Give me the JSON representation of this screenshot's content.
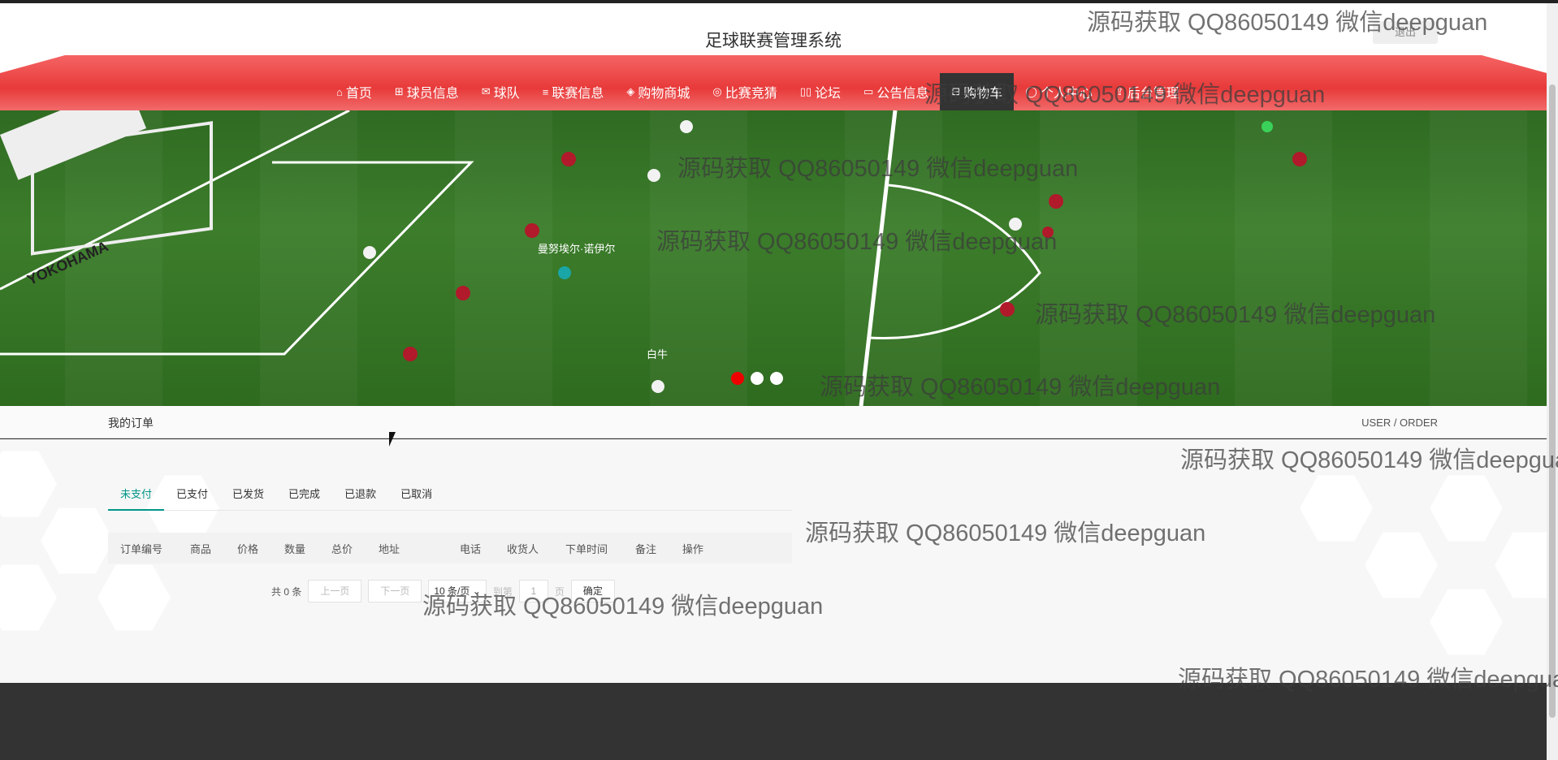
{
  "header": {
    "title": "足球联赛管理系统",
    "logout_label": "退出"
  },
  "nav": {
    "items": [
      {
        "icon": "⌂",
        "icon_name": "home-icon",
        "label": "首页"
      },
      {
        "icon": "⊞",
        "icon_name": "gift-icon",
        "label": "球员信息"
      },
      {
        "icon": "✉",
        "icon_name": "mail-icon",
        "label": "球队"
      },
      {
        "icon": "≡",
        "icon_name": "sliders-icon",
        "label": "联赛信息"
      },
      {
        "icon": "◈",
        "icon_name": "tag-icon",
        "label": "购物商城"
      },
      {
        "icon": "◎",
        "icon_name": "palette-icon",
        "label": "比赛竞猜"
      },
      {
        "icon": "▯▯",
        "icon_name": "columns-icon",
        "label": "论坛"
      },
      {
        "icon": "▭",
        "icon_name": "book-icon",
        "label": "公告信息"
      },
      {
        "icon": "⊟",
        "icon_name": "cart-icon",
        "label": "购物车"
      },
      {
        "icon": "◯",
        "icon_name": "user-icon",
        "label": "个人中心"
      },
      {
        "icon": "⇪",
        "icon_name": "share-icon",
        "label": "后台管理"
      }
    ],
    "active_index": 8
  },
  "banner": {
    "board_text": "YOKOHAMA",
    "player1": "曼努埃尔·诺伊尔",
    "player2": "白牛",
    "slides": 3,
    "active_slide": 0
  },
  "section": {
    "title": "我的订单",
    "crumb": "USER / ORDER"
  },
  "tabs": [
    "未支付",
    "已支付",
    "已发货",
    "已完成",
    "已退款",
    "已取消"
  ],
  "table": {
    "columns": [
      "订单编号",
      "商品",
      "价格",
      "数量",
      "总价",
      "地址",
      "电话",
      "收货人",
      "下单时间",
      "备注",
      "操作"
    ]
  },
  "pager": {
    "total": "共 0 条",
    "prev": "上一页",
    "next": "下一页",
    "per_page": "10 条/页",
    "goto_label": "到第",
    "page_value": "1",
    "page_unit": "页",
    "confirm": "确定"
  },
  "watermark": "源码获取 QQ86050149 微信deepguan",
  "colors": {
    "nav_red": "#e83a3a",
    "accent": "#009688",
    "active_dot": "#e00000"
  }
}
